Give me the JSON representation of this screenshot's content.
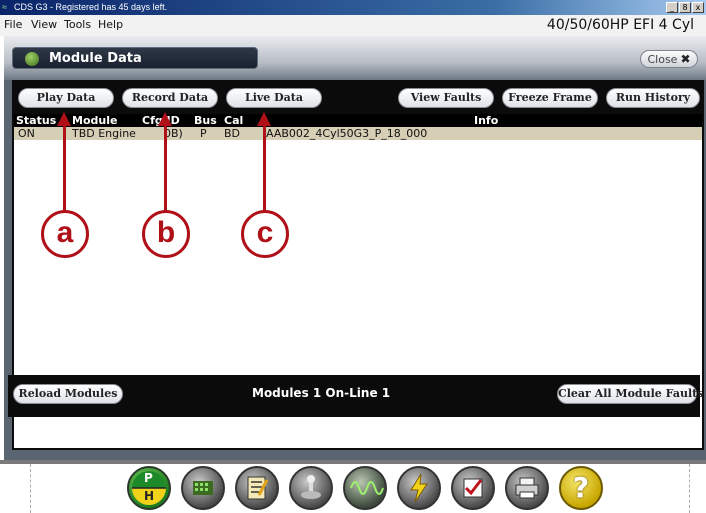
{
  "window": {
    "title": "CDS G3 - Registered has 45 days left.",
    "buttons": [
      "_",
      "8",
      "x"
    ]
  },
  "menu": {
    "items": [
      "File",
      "View",
      "Tools",
      "Help"
    ],
    "engine": "40/50/60HP EFI 4 Cyl"
  },
  "module_panel": {
    "title": "Module Data",
    "close_label": "Close",
    "close_icon": "✖"
  },
  "toolbar_buttons": [
    "Play Data",
    "Record Data",
    "Live Data",
    "View Faults",
    "Freeze Frame",
    "Run History"
  ],
  "grid": {
    "headers": {
      "status": "Status",
      "module": "Module",
      "cfg_id": "Cfg ID",
      "bus": "Bus",
      "cal": "Cal",
      "info": "Info"
    },
    "row": {
      "status": "ON",
      "module": "TBD Engine",
      "cfg_id": "0B)",
      "bus": "P",
      "cal": "BD",
      "cal_rest": "AAB002_4Cyl50G3_P_18_000"
    }
  },
  "footer": {
    "reload": "Reload Modules",
    "status": "Modules  1   On-Line  1",
    "clear": "Clear All Module Faults"
  },
  "callouts": [
    "a",
    "b",
    "c"
  ],
  "bottom_tools": {
    "ph_top": "P",
    "ph_bottom": "H",
    "icons": [
      "engine-grid-icon",
      "checklist-icon",
      "joystick-icon",
      "waveform-icon",
      "lightning-icon",
      "checkbox-icon",
      "printer-icon",
      "help-icon"
    ],
    "help_glyph": "?"
  },
  "colors": {
    "callout": "#b01018",
    "selected_row": "#d7ceb6"
  }
}
